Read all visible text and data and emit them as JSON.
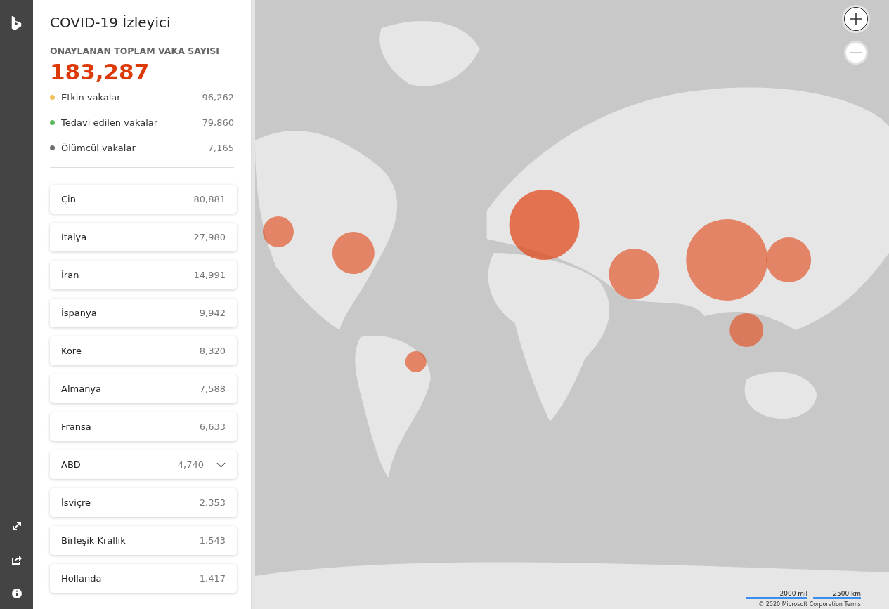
{
  "app": {
    "title": "COVID-19 İzleyici"
  },
  "summary": {
    "label": "ONAYLANAN TOPLAM VAKA SAYISI",
    "total": "183,287",
    "stats": [
      {
        "label": "Etkin vakalar",
        "value": "96,262",
        "color": "#f2c05c"
      },
      {
        "label": "Tedavi edilen vakalar",
        "value": "79,860",
        "color": "#5cb85c"
      },
      {
        "label": "Ölümcül vakalar",
        "value": "7,165",
        "color": "#6e6e6e"
      }
    ]
  },
  "countries": [
    {
      "name": "Çin",
      "count": "80,881",
      "expandable": false
    },
    {
      "name": "İtalya",
      "count": "27,980",
      "expandable": false
    },
    {
      "name": "İran",
      "count": "14,991",
      "expandable": false
    },
    {
      "name": "İspanya",
      "count": "9,942",
      "expandable": false
    },
    {
      "name": "Kore",
      "count": "8,320",
      "expandable": false
    },
    {
      "name": "Almanya",
      "count": "7,588",
      "expandable": false
    },
    {
      "name": "Fransa",
      "count": "6,633",
      "expandable": false
    },
    {
      "name": "ABD",
      "count": "4,740",
      "expandable": true
    },
    {
      "name": "İsviçre",
      "count": "2,353",
      "expandable": false
    },
    {
      "name": "Birleşik Krallık",
      "count": "1,543",
      "expandable": false
    },
    {
      "name": "Hollanda",
      "count": "1,417",
      "expandable": false
    }
  ],
  "map": {
    "scales": [
      "2000 mil",
      "2500 km"
    ],
    "copyright": "© 2020 Microsoft Corporation Terms"
  }
}
